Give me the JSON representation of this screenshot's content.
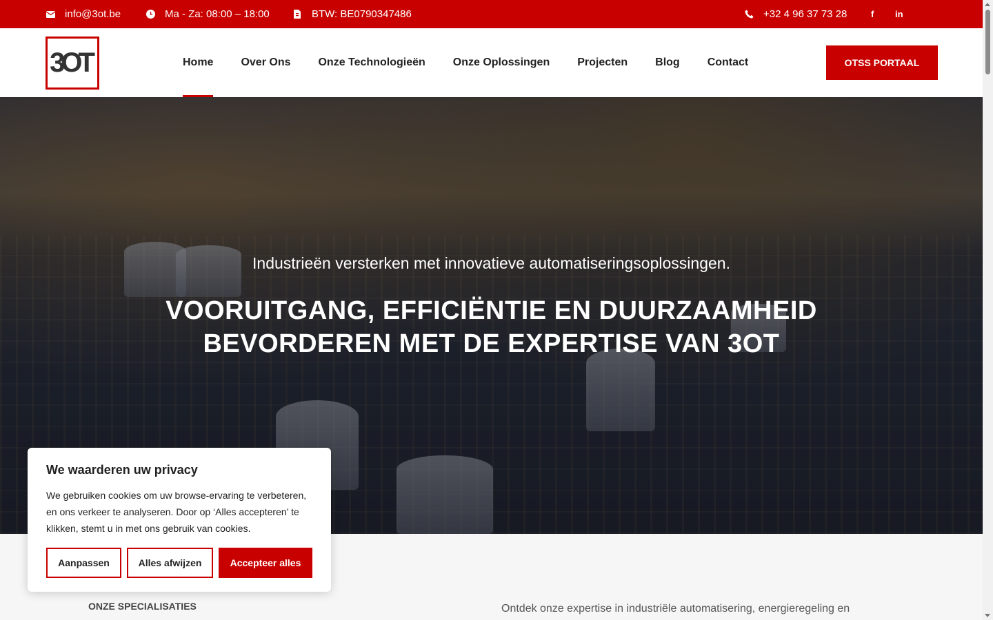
{
  "topbar": {
    "email": "info@3ot.be",
    "hours": "Ma - Za: 08:00 – 18:00",
    "vat": "BTW: BE0790347486",
    "phone": "+32 4 96 37 73 28",
    "facebook": "f",
    "linkedin": "in"
  },
  "header": {
    "logo_text": "3OT",
    "nav": [
      "Home",
      "Over Ons",
      "Onze Technologieën",
      "Onze Oplossingen",
      "Projecten",
      "Blog",
      "Contact"
    ],
    "portal_label": "OTSS PORTAAL"
  },
  "hero": {
    "subtitle": "Industrieën versterken met innovatieve automatiseringsoplossingen.",
    "title_line1": "VOORUITGANG, EFFICIËNTIE EN DUURZAAMHEID",
    "title_line2": "BEVORDEREN MET DE EXPERTISE VAN 3OT"
  },
  "cookie": {
    "title": "We waarderen uw privacy",
    "text": "We gebruiken cookies om uw browse-ervaring te verbeteren, en ons verkeer te analyseren. Door op ‘Alles accepteren’ te klikken, stemt u in met ons gebruik van cookies.",
    "customize": "Aanpassen",
    "reject": "Alles afwijzen",
    "accept": "Accepteer alles"
  },
  "section": {
    "label": "ONZE SPECIALISATIES",
    "intro": "Ontdek onze expertise in industriële automatisering, energieregeling en"
  },
  "colors": {
    "accent": "#c90000"
  }
}
